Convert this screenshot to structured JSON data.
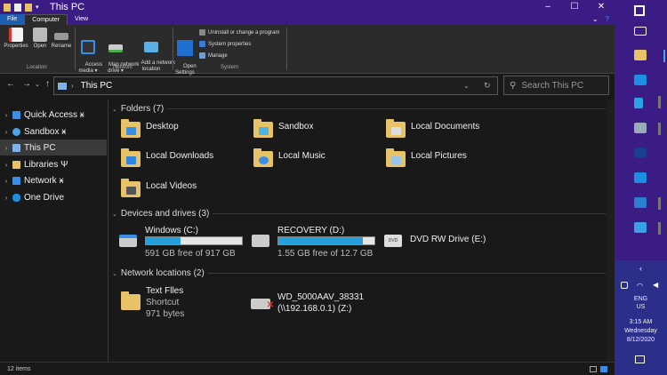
{
  "window": {
    "title": "This PC",
    "controls": [
      "–",
      "☐",
      "✕"
    ]
  },
  "ribbon": {
    "tabs": [
      "File",
      "Computer",
      "View"
    ],
    "help": "?",
    "collapse": "⌄",
    "buttons": [
      {
        "label": "Properties",
        "icon": "properties-icon"
      },
      {
        "label": "Open",
        "icon": "open-icon"
      },
      {
        "label": "Rename",
        "icon": "rename-icon"
      },
      {
        "label": "Access\nmedia ▾",
        "icon": "access-media-icon"
      },
      {
        "label": "Map network\ndrive ▾",
        "icon": "map-network-drive-icon"
      },
      {
        "label": "Add a network\nlocation",
        "icon": "add-network-location-icon"
      },
      {
        "label": "Open\nSettings",
        "icon": "settings-icon"
      }
    ],
    "system_items": [
      "Uninstall or change a program",
      "System properties",
      "Manage"
    ],
    "groups": [
      "Location",
      "Network",
      "System"
    ]
  },
  "address": {
    "path": "This PC",
    "search_placeholder": "Search This PC"
  },
  "nav_pane": [
    {
      "label": "Quick Access ӿ",
      "color": "#3a8ee6"
    },
    {
      "label": "Sandbox ӿ",
      "color": "#4aa3e6"
    },
    {
      "label": "This PC",
      "color": "#7fb2e6",
      "selected": true
    },
    {
      "label": "Libraries Ψ",
      "color": "#e8c266"
    },
    {
      "label": "Network ӿ",
      "color": "#3a8ee6"
    },
    {
      "label": "One Drive",
      "color": "#1e8fe0"
    }
  ],
  "sections": {
    "folders": "Folders (7)",
    "drives": "Devices and drives (3)",
    "network": "Network locations (2)"
  },
  "folders": [
    {
      "name": "Desktop",
      "badge": "#3a8ee6"
    },
    {
      "name": "Sandbox",
      "badge": "#4bb3e6"
    },
    {
      "name": "Local Documents",
      "badge": "#dddddd"
    },
    {
      "name": "Local Downloads",
      "badge": "#2f86de"
    },
    {
      "name": "Local Music",
      "badge": "#3a8ee6"
    },
    {
      "name": "Local Pictures",
      "badge": "#9ac5ea"
    },
    {
      "name": "Local Videos",
      "badge": "#555555"
    }
  ],
  "drives": [
    {
      "name": "Windows (C:)",
      "free": "591 GB free of 917 GB",
      "used_fraction": 0.36
    },
    {
      "name": "RECOVERY (D:)",
      "free": "1.55 GB free of 12.7 GB",
      "used_fraction": 0.88
    },
    {
      "name": "DVD RW Drive (E:)"
    }
  ],
  "network_locations": [
    {
      "name": "Text Flles",
      "line2": "Shortcut",
      "line3": "971 bytes"
    },
    {
      "name": "WD_5000AAV_38331",
      "line2": "(\\\\192.168.0.1) (Z:)"
    }
  ],
  "status": {
    "items": "12 items"
  },
  "taskbar": {
    "lang": "ENG",
    "region": "US",
    "time": "3:15 AM",
    "day": "Wednesday",
    "date": "8/12/2020"
  }
}
